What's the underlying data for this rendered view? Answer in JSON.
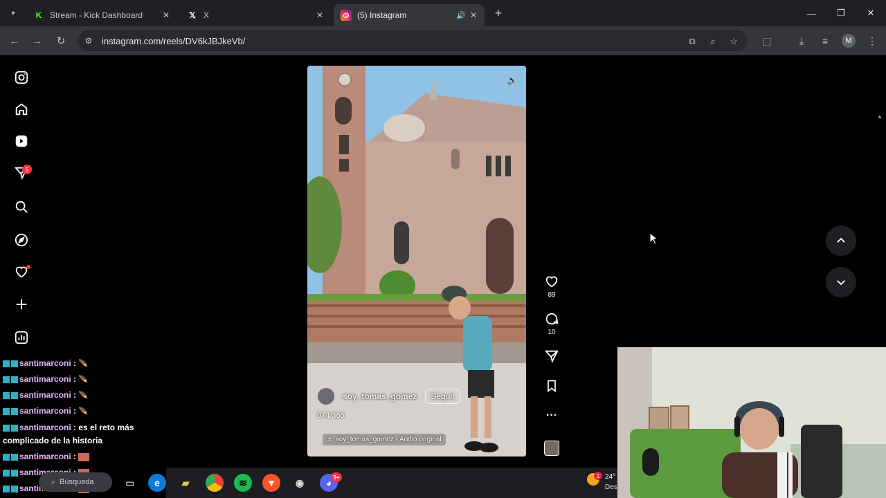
{
  "browser": {
    "tabs": [
      {
        "title": "Stream - Kick Dashboard",
        "favicon": "kick-icon",
        "active": false
      },
      {
        "title": "X",
        "favicon": "x-icon",
        "active": false
      },
      {
        "title": "(5) Instagram",
        "favicon": "instagram-icon",
        "active": true,
        "audio": true
      }
    ],
    "url": "instagram.com/reels/DV6kJBJkeVb/",
    "profile_initial": "M"
  },
  "instagram": {
    "sidebar": {
      "items": [
        {
          "name": "instagram-logo-icon"
        },
        {
          "name": "home-icon"
        },
        {
          "name": "reels-icon"
        },
        {
          "name": "direct-messages-icon",
          "badge": "5"
        },
        {
          "name": "search-icon"
        },
        {
          "name": "explore-icon"
        },
        {
          "name": "notifications-heart-icon",
          "dot": true
        },
        {
          "name": "create-plus-icon"
        },
        {
          "name": "dashboard-icon"
        }
      ]
    },
    "reel": {
      "username": "soy_tomas_gomez",
      "follow_label": "Seguir",
      "caption": "074/365",
      "audio": "soy_tomas_gomez · Audio original"
    },
    "actions": {
      "likes": "89",
      "comments": "10"
    }
  },
  "chat": {
    "messages": [
      {
        "user": "santimarconi",
        "text": ":"
      },
      {
        "user": "santimarconi",
        "text": ":"
      },
      {
        "user": "santimarconi",
        "text": ":"
      },
      {
        "user": "santimarconi",
        "text": ":"
      },
      {
        "user": "santimarconi",
        "text": ": es el reto más",
        "text2": "complicado de la historia"
      },
      {
        "user": "santimarconi",
        "text": ":"
      },
      {
        "user": "santimarconi",
        "text": ":"
      },
      {
        "user": "santimarconi",
        "text": ":"
      }
    ]
  },
  "taskbar": {
    "search_label": "Búsqueda",
    "weather_temp": "24°",
    "weather_cond": "Des",
    "notif_count": "1",
    "discord_badge": "9+"
  },
  "colors": {
    "accent_red": "#ff3040",
    "chat_nick": "#e7b6ff",
    "kick_green": "#53fc18"
  }
}
